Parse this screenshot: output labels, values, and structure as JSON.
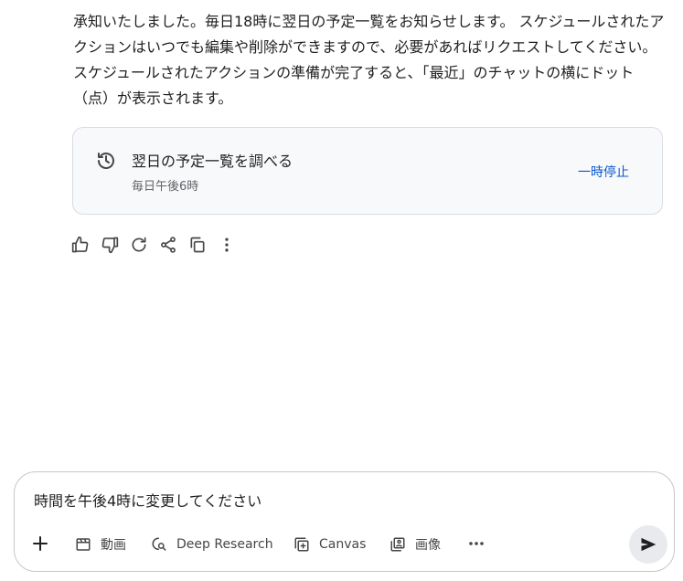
{
  "response": {
    "lines": [
      "承知いたしました。毎日18時に翌日の予定一覧をお知らせします。 スケジュールされたア",
      "クションはいつでも編集や削除ができますので、必要があればリクエストしてください。",
      "スケジュールされたアクションの準備が完了すると、「最近」のチャットの横にドット",
      "（点）が表示されます。"
    ]
  },
  "scheduled_action": {
    "icon": "history-icon",
    "title": "翌日の予定一覧を調べる",
    "schedule": "毎日午後6時",
    "pause_label": "一時停止"
  },
  "feedback_icons": [
    "thumbs-up-icon",
    "thumbs-down-icon",
    "regenerate-icon",
    "share-icon",
    "copy-icon",
    "more-vert-icon"
  ],
  "composer": {
    "input_value": "時間を午後4時に変更してください",
    "tools": [
      {
        "icon": "video-icon",
        "label": "動画"
      },
      {
        "icon": "deep-research-icon",
        "label": "Deep Research"
      },
      {
        "icon": "canvas-icon",
        "label": "Canvas"
      },
      {
        "icon": "image-icon",
        "label": "画像"
      }
    ],
    "more_icon": "more-horiz-icon",
    "send_icon": "send-icon"
  },
  "colors": {
    "accent": "#0b57d0",
    "text": "#1f1f1f",
    "muted": "#5f6368",
    "card_bg": "#f8f9fa",
    "send_bg": "#e8eaed"
  }
}
